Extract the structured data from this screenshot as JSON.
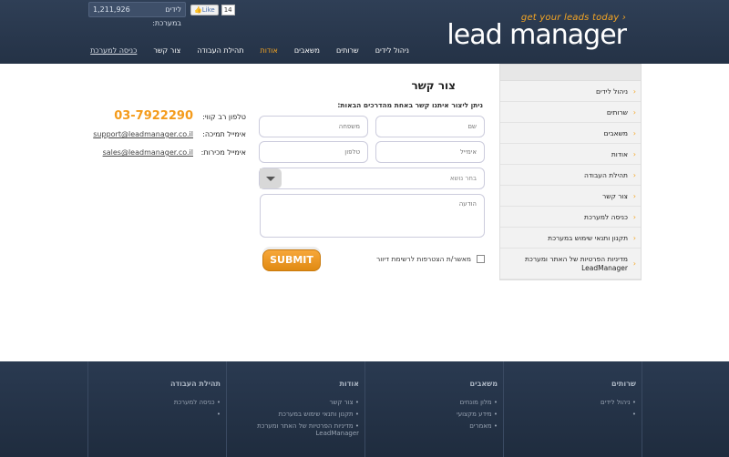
{
  "header": {
    "counter_label": "לידים במערכת:",
    "counter_value": "1,211,926",
    "like_label": "Like",
    "like_count": "14",
    "tagline": "get your leads today",
    "logo": "lead manager"
  },
  "nav": [
    {
      "label": "ניהול לידים"
    },
    {
      "label": "שרותים"
    },
    {
      "label": "משאבים"
    },
    {
      "label": "אודות",
      "active": true
    },
    {
      "label": "תהילת העבודה"
    },
    {
      "label": "צור קשר"
    },
    {
      "label": "כניסה למערכת"
    }
  ],
  "form": {
    "title": "צור קשר",
    "subtitle": "ניתן ליצור איתנו קשר באחת מהדרכים הבאות:",
    "name_placeholder": "שם",
    "family_placeholder": "משפחה",
    "email_placeholder": "אימייל",
    "phone_placeholder": "טלפון",
    "subject_placeholder": "בחר נושא",
    "message_placeholder": "הודעה",
    "newsletter_label": "מאשר/ת הצטרפות לרשימת דיוור",
    "submit_label": "SUBMIT"
  },
  "contact": {
    "phone_label": "טלפון רב קווי:",
    "phone": "03-7922290",
    "support_label": "אימייל תמיכה:",
    "support_email": "support@leadmanager.co.il",
    "sales_label": "אימייל מכירות:",
    "sales_email": "sales@leadmanager.co.il"
  },
  "sidebar": [
    {
      "label": "ניהול לידים"
    },
    {
      "label": "שרותים"
    },
    {
      "label": "משאבים"
    },
    {
      "label": "אודות"
    },
    {
      "label": "תהילת העבודה"
    },
    {
      "label": "צור קשר"
    },
    {
      "label": "כניסה למערכת"
    },
    {
      "label": "תקנון ותנאי שימוש במערכת"
    },
    {
      "label": "מדיניות הפרטיות של האתר ומערכת LeadManager"
    }
  ],
  "footer": {
    "columns": [
      {
        "title": "שרותים",
        "items": [
          "ניהול לידים",
          ""
        ]
      },
      {
        "title": "משאבים",
        "items": [
          "מלון מונחים",
          "מידע מקצועי",
          "מאמרים"
        ]
      },
      {
        "title": "אודות",
        "items": [
          "צור קשר",
          "תקנון ותנאי שימוש במערכת",
          "מדיניות הפרטיות של האתר ומערכת LeadManager"
        ]
      },
      {
        "title": "תהילת העבודה",
        "items": [
          "כניסה למערכת",
          ""
        ]
      }
    ]
  }
}
